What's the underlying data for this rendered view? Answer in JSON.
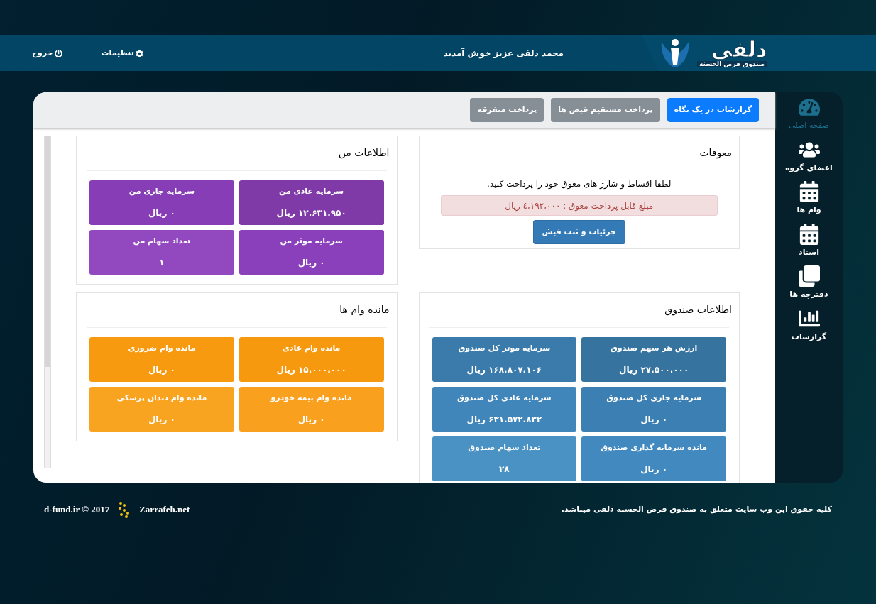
{
  "header": {
    "logo": {
      "title": "دلفی",
      "subtitle": "صندوق قرض الحسنه"
    },
    "welcome": "محمد دلفی عزیز خوش آمدید",
    "links": [
      {
        "label": "تنظیمات",
        "kind": "settings"
      },
      {
        "label": "خروج",
        "kind": "logout"
      }
    ]
  },
  "sidebar": {
    "items": [
      {
        "label": "صفحه اصلی",
        "kind": "gauge",
        "selected": true
      },
      {
        "label": "اعضای گروه",
        "kind": "users",
        "selected": false
      },
      {
        "label": "وام ها",
        "kind": "calendar",
        "selected": false
      },
      {
        "label": "اسناد",
        "kind": "calendar",
        "selected": false
      },
      {
        "label": "دفترچه ها",
        "kind": "copies",
        "selected": false
      },
      {
        "label": "گزارشات",
        "kind": "chart",
        "selected": false
      }
    ]
  },
  "tabs": [
    {
      "label": "گزارشات در یک نگاه",
      "selected": true
    },
    {
      "label": "پرداخت مستقیم قبض ها",
      "selected": false
    },
    {
      "label": "پرداخت متفرقه",
      "selected": false
    }
  ],
  "overdue": {
    "title": "معوقات",
    "message": "لطفا اقساط و شارژ های معوق خود را پرداخت کنید.",
    "alert": "مبلغ قابل پرداخت معوق : ٤,١٩٢,٠٠٠ ریال",
    "button": "جزئیات و ثبت فیش"
  },
  "my_info": {
    "title": "اطلاعات من",
    "tiles": [
      {
        "label": "سرمایه عادی من",
        "value": "۱۲.۶۳۱.۹۵۰ ریال",
        "color": "#7f3aa8"
      },
      {
        "label": "سرمایه جاری من",
        "value": "۰ ریال",
        "color": "#863db5"
      },
      {
        "label": "سرمایه موثر من",
        "value": "۰ ریال",
        "color": "#8a3fbb"
      },
      {
        "label": "تعداد سهام من",
        "value": "۱",
        "color": "#9249bf"
      }
    ]
  },
  "fund_info": {
    "title": "اطلاعات صندوق",
    "tiles": [
      {
        "label": "ارزش هر سهم صندوق",
        "value": "۲۷.۵۰۰.۰۰۰ ریال",
        "color": "#36739f"
      },
      {
        "label": "سرمایه موثر کل صندوق",
        "value": "۱۶۸.۸۰۷.۱۰۶ ریال",
        "color": "#3a7bab"
      },
      {
        "label": "سرمایه جاری کل صندوق",
        "value": "۰ ریال",
        "color": "#3c7fb3"
      },
      {
        "label": "سرمایه عادی کل صندوق",
        "value": "۶۳۱.۵۷۲.۸۳۲ ریال",
        "color": "#4086bb"
      },
      {
        "label": "مانده سرمایه گذاری صندوق",
        "value": "۰ ریال",
        "color": "#4289c0"
      },
      {
        "label": "تعداد سهام صندوق",
        "value": "۲۸",
        "color": "#4b92c4"
      }
    ]
  },
  "loans": {
    "title": "مانده وام ها",
    "tiles": [
      {
        "label": "مانده وام عادی",
        "value": "۱۵.۰۰۰.۰۰۰ ریال",
        "color": "#f7990f"
      },
      {
        "label": "مانده وام ضروری",
        "value": "۰ ریال",
        "color": "#f79a10"
      },
      {
        "label": "مانده وام بیمه خودرو",
        "value": "۰ ریال",
        "color": "#f9a11f"
      },
      {
        "label": "مانده وام دندان پزشکی",
        "value": "۰ ریال",
        "color": "#f9a421"
      }
    ]
  },
  "footer": {
    "copyright": "کلیه حقوق این وب سایت متعلق به صندوق قرض الحسنه دلفی میباشد.",
    "designer": "Zarrafeh.net",
    "site": "d-fund.ir © 2017"
  }
}
